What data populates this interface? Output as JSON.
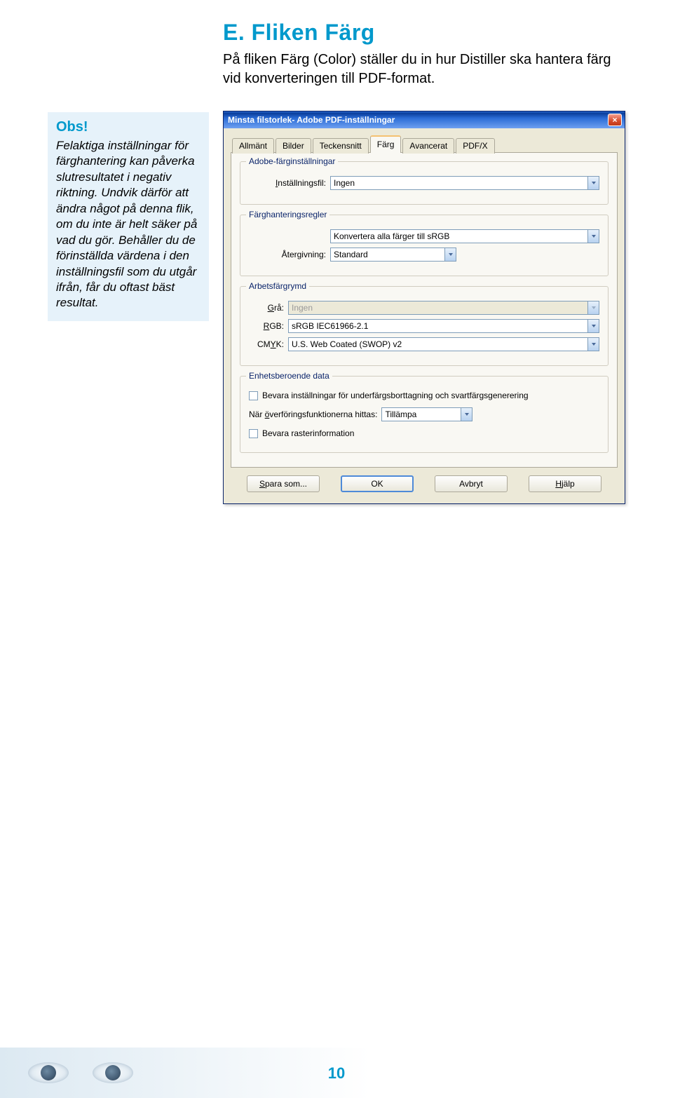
{
  "heading": "E. Fliken Färg",
  "intro": "På fliken Färg (Color) ställer du in hur Distiller ska hantera färg vid konverteringen till PDF-format.",
  "note": {
    "title": "Obs!",
    "text": "Felaktiga inställningar för färghantering kan påverka slutresultatet i negativ riktning. Undvik därför att ändra något på denna flik, om du inte är helt säker på vad du gör. Behåller du de förinställda värdena i den inställningsfil som du utgår ifrån, får du oftast bäst resultat."
  },
  "dialog": {
    "title": "Minsta filstorlek- Adobe PDF-inställningar",
    "close": "×",
    "tabs": [
      "Allmänt",
      "Bilder",
      "Teckensnitt",
      "Färg",
      "Avancerat",
      "PDF/X"
    ],
    "active_tab": "Färg",
    "group_adobe": {
      "title": "Adobe-färginställningar",
      "settings_label": "Inställningsfil:",
      "settings_value": "Ingen"
    },
    "group_rules": {
      "title": "Färghanteringsregler",
      "convert_value": "Konvertera alla färger till sRGB",
      "render_label": "Återgivning:",
      "render_value": "Standard"
    },
    "group_workspace": {
      "title": "Arbetsfärgrymd",
      "gray_label": "Grå:",
      "gray_value": "Ingen",
      "rgb_label": "RGB:",
      "rgb_value": "sRGB IEC61966-2.1",
      "cmyk_label": "CMYK:",
      "cmyk_value": "U.S. Web Coated (SWOP) v2"
    },
    "group_device": {
      "title": "Enhetsberoende data",
      "chk1": "Bevara inställningar för underfärgsborttagning och svartfärgsgenerering",
      "transfer_label": "När överföringsfunktionerna hittas:",
      "transfer_value": "Tillämpa",
      "chk2": "Bevara rasterinformation"
    },
    "buttons": {
      "save": "Spara som...",
      "ok": "OK",
      "cancel": "Avbryt",
      "help": "Hjälp"
    }
  },
  "page_number": "10"
}
